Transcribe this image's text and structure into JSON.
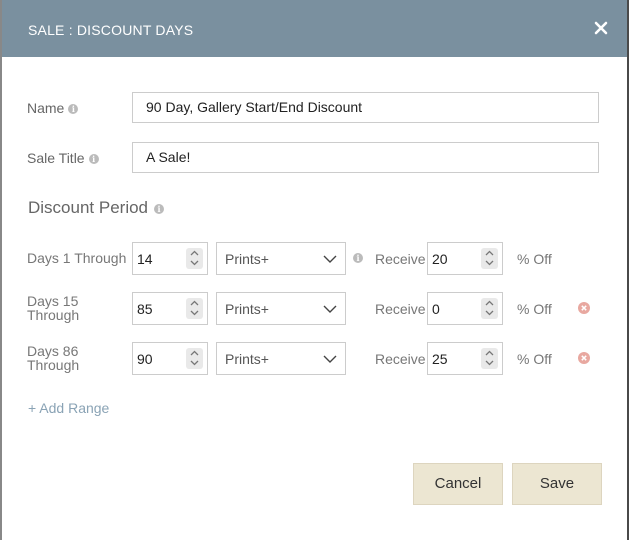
{
  "modal": {
    "title": "SALE : DISCOUNT DAYS"
  },
  "form": {
    "name_label": "Name",
    "name_value": "90 Day, Gallery Start/End Discount",
    "sale_title_label": "Sale Title",
    "sale_title_value": "A Sale!",
    "discount_period_title": "Discount Period"
  },
  "ranges": [
    {
      "label_line1": "Days 1 Through",
      "label_line2": "",
      "through_value": "14",
      "product": "Prints+",
      "receive_label": "Receive",
      "discount": "20",
      "off_label": "% Off"
    },
    {
      "label_line1": "Days 15",
      "label_line2": "Through",
      "through_value": "85",
      "product": "Prints+",
      "receive_label": "Receive",
      "discount": "0",
      "off_label": "% Off"
    },
    {
      "label_line1": "Days 86",
      "label_line2": "Through",
      "through_value": "90",
      "product": "Prints+",
      "receive_label": "Receive",
      "discount": "25",
      "off_label": "% Off"
    }
  ],
  "add_range_label": "+ Add Range",
  "buttons": {
    "cancel": "Cancel",
    "save": "Save"
  },
  "colors": {
    "header": "#7a909f",
    "button_bg": "#ece6d2",
    "remove_icon": "#e8a8a0",
    "link": "#8aa3b5"
  }
}
